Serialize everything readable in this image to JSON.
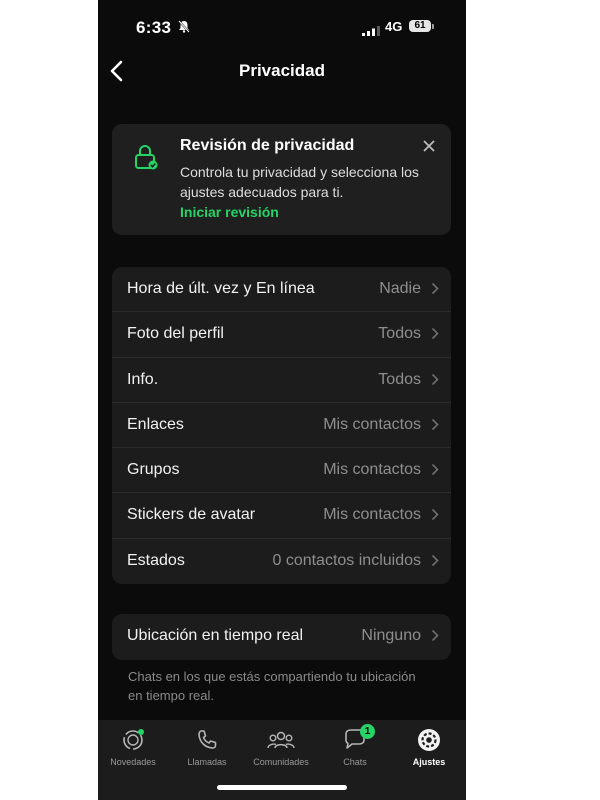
{
  "status_bar": {
    "time": "6:33",
    "network": "4G",
    "battery": "61"
  },
  "header": {
    "title": "Privacidad"
  },
  "privacy_review": {
    "title": "Revisión de privacidad",
    "description": "Controla tu privacidad y selecciona los ajustes adecuados para ti.",
    "link": "Iniciar revisión"
  },
  "settings": [
    {
      "label": "Hora de últ. vez y En línea",
      "value": "Nadie"
    },
    {
      "label": "Foto del perfil",
      "value": "Todos"
    },
    {
      "label": "Info.",
      "value": "Todos"
    },
    {
      "label": "Enlaces",
      "value": "Mis contactos"
    },
    {
      "label": "Grupos",
      "value": "Mis contactos"
    },
    {
      "label": "Stickers de avatar",
      "value": "Mis contactos"
    },
    {
      "label": "Estados",
      "value": "0 contactos incluidos"
    }
  ],
  "location": {
    "label": "Ubicación en tiempo real",
    "value": "Ninguno",
    "note": "Chats en los que estás compartiendo tu ubicación en tiempo real."
  },
  "tabs": [
    {
      "label": "Novedades",
      "icon": "status-icon"
    },
    {
      "label": "Llamadas",
      "icon": "phone-icon"
    },
    {
      "label": "Comunidades",
      "icon": "communities-icon"
    },
    {
      "label": "Chats",
      "icon": "chat-icon",
      "badge": "1"
    },
    {
      "label": "Ajustes",
      "icon": "settings-icon",
      "active": true
    }
  ],
  "colors": {
    "accent": "#25d366",
    "background": "#0b0b0b",
    "card": "#1c1c1c"
  }
}
